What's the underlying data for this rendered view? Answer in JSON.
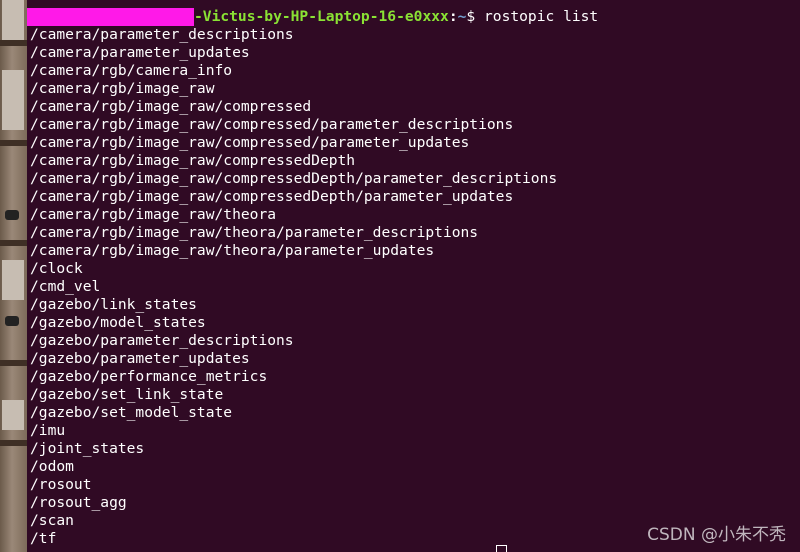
{
  "terminal": {
    "prompt": {
      "user_host": "-Victus-by-HP-Laptop-16-e0xxx",
      "separator": ":",
      "cwd": "~",
      "symbol": "$",
      "command": "rostopic list"
    },
    "output": [
      "/camera/parameter_descriptions",
      "/camera/parameter_updates",
      "/camera/rgb/camera_info",
      "/camera/rgb/image_raw",
      "/camera/rgb/image_raw/compressed",
      "/camera/rgb/image_raw/compressed/parameter_descriptions",
      "/camera/rgb/image_raw/compressed/parameter_updates",
      "/camera/rgb/image_raw/compressedDepth",
      "/camera/rgb/image_raw/compressedDepth/parameter_descriptions",
      "/camera/rgb/image_raw/compressedDepth/parameter_updates",
      "/camera/rgb/image_raw/theora",
      "/camera/rgb/image_raw/theora/parameter_descriptions",
      "/camera/rgb/image_raw/theora/parameter_updates",
      "/clock",
      "/cmd_vel",
      "/gazebo/link_states",
      "/gazebo/model_states",
      "/gazebo/parameter_descriptions",
      "/gazebo/parameter_updates",
      "/gazebo/performance_metrics",
      "/gazebo/set_link_state",
      "/gazebo/set_model_state",
      "/imu",
      "/joint_states",
      "/odom",
      "/rosout",
      "/rosout_agg",
      "/scan",
      "/tf"
    ]
  },
  "watermark": "CSDN @小朱不秃",
  "colors": {
    "background": "#300a24",
    "prompt_user": "#8ae234",
    "prompt_path": "#729fcf",
    "redaction": "#ff19e8"
  }
}
